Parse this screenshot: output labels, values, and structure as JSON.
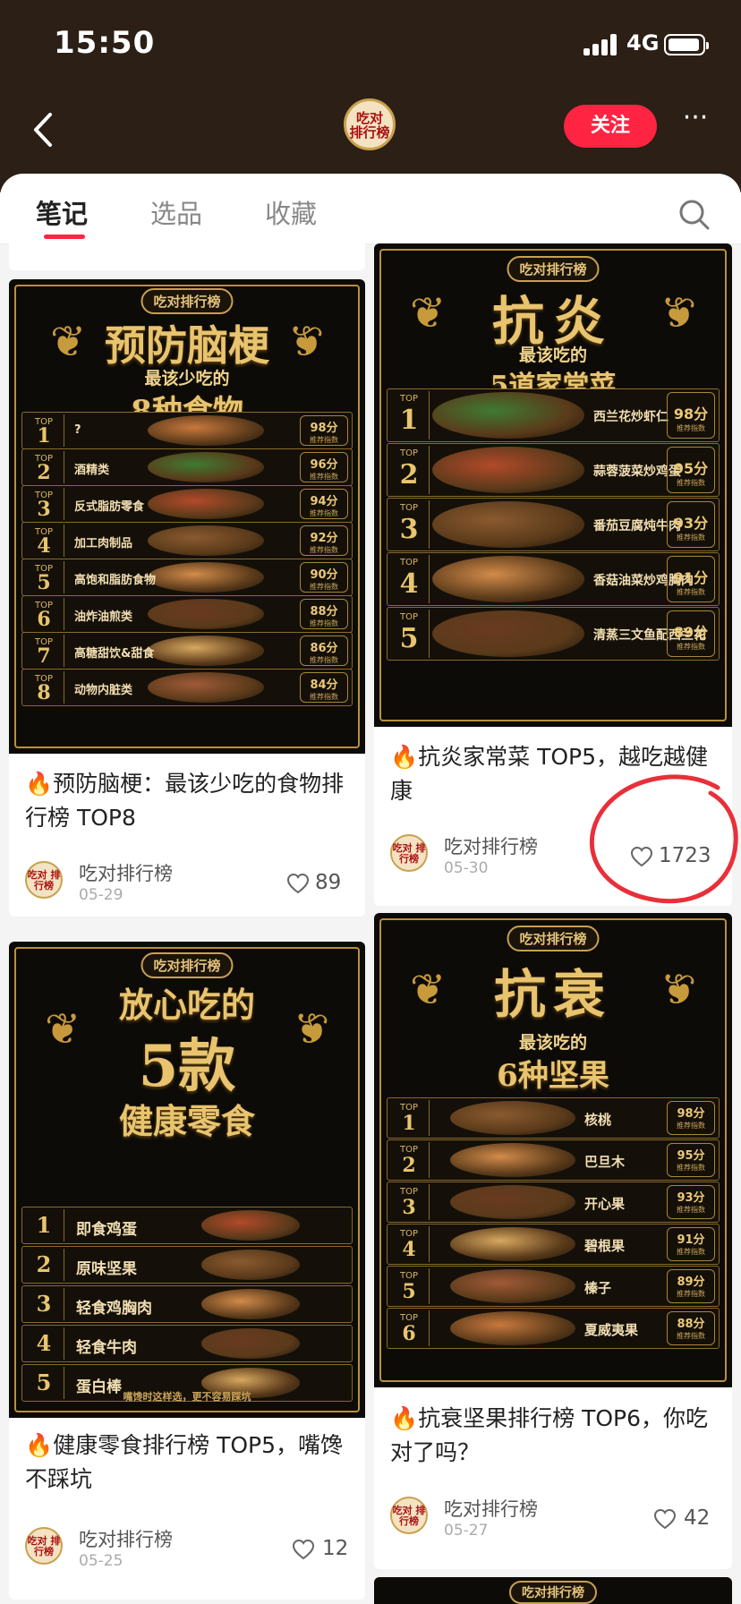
{
  "status": {
    "time": "15:50",
    "network": "4G"
  },
  "header": {
    "logo_text": "吃对\n排行榜",
    "follow_label": "关注",
    "more_label": "···"
  },
  "tabs": [
    {
      "label": "笔记",
      "active": true
    },
    {
      "label": "选品",
      "active": false
    },
    {
      "label": "收藏",
      "active": false
    }
  ],
  "author": {
    "name": "吃对排行榜",
    "avatar_text": "吃对\n排行榜"
  },
  "posts": [
    {
      "title": "🔥预防脑梗：最该少吃的食物排行榜 TOP8",
      "date": "05-29",
      "likes": "89",
      "poster": {
        "tag": "吃对排行榜",
        "headline": "预防脑梗",
        "sub": "最该少吃的",
        "sub2": "8种食物",
        "rows": [
          {
            "rank": "1",
            "name": "?",
            "score": "98分"
          },
          {
            "rank": "2",
            "name": "酒精类",
            "score": "96分"
          },
          {
            "rank": "3",
            "name": "反式脂肪零食",
            "score": "94分"
          },
          {
            "rank": "4",
            "name": "加工肉制品",
            "score": "92分"
          },
          {
            "rank": "5",
            "name": "高饱和脂肪食物",
            "score": "90分"
          },
          {
            "rank": "6",
            "name": "油炸油煎类",
            "score": "88分"
          },
          {
            "rank": "7",
            "name": "高糖甜饮&甜食",
            "score": "86分"
          },
          {
            "rank": "8",
            "name": "动物内脏类",
            "score": "84分"
          }
        ]
      }
    },
    {
      "title": "🔥抗炎家常菜 TOP5，越吃越健康",
      "date": "05-30",
      "likes": "1723",
      "poster": {
        "tag": "吃对排行榜",
        "headline": "抗炎",
        "sub": "最该吃的",
        "sub2": "5道家常菜",
        "rows": [
          {
            "rank": "1",
            "name": "西兰花炒虾仁",
            "score": "98分"
          },
          {
            "rank": "2",
            "name": "蒜蓉菠菜炒鸡蛋",
            "score": "95分"
          },
          {
            "rank": "3",
            "name": "番茄豆腐炖牛肉",
            "score": "93分"
          },
          {
            "rank": "4",
            "name": "香菇油菜炒鸡胸肉",
            "score": "91分"
          },
          {
            "rank": "5",
            "name": "清蒸三文鱼配西兰花",
            "score": "89分"
          }
        ]
      }
    },
    {
      "title": "🔥健康零食排行榜 TOP5，嘴馋不踩坑",
      "date": "05-25",
      "likes": "12",
      "poster": {
        "tag": "吃对排行榜",
        "headline": "放心吃的",
        "big": "5款",
        "sub2": "健康零食",
        "footer": "嘴馋时这样选，更不容易踩坑",
        "rows": [
          {
            "rank": "1",
            "name": "即食鸡蛋"
          },
          {
            "rank": "2",
            "name": "原味坚果"
          },
          {
            "rank": "3",
            "name": "轻食鸡胸肉"
          },
          {
            "rank": "4",
            "name": "轻食牛肉"
          },
          {
            "rank": "5",
            "name": "蛋白棒"
          }
        ]
      }
    },
    {
      "title": "🔥抗衰坚果排行榜 TOP6，你吃对了吗？",
      "date": "05-27",
      "likes": "42",
      "poster": {
        "tag": "吃对排行榜",
        "headline": "抗衰",
        "sub": "最该吃的",
        "sub2": "6种坚果",
        "rows": [
          {
            "rank": "1",
            "name": "核桃",
            "score": "98分"
          },
          {
            "rank": "2",
            "name": "巴旦木",
            "score": "95分"
          },
          {
            "rank": "3",
            "name": "开心果",
            "score": "93分"
          },
          {
            "rank": "4",
            "name": "碧根果",
            "score": "91分"
          },
          {
            "rank": "5",
            "name": "榛子",
            "score": "89分"
          },
          {
            "rank": "6",
            "name": "夏威夷果",
            "score": "88分"
          }
        ]
      }
    }
  ],
  "top_label": "TOP",
  "score_label": "推荐指数",
  "partial_card_tag": "吃对排行榜",
  "colors": {
    "accent": "#ff2442",
    "header_bg": "#2b1f16",
    "gold": "#e9c46f",
    "annotation": "#e8303a"
  }
}
